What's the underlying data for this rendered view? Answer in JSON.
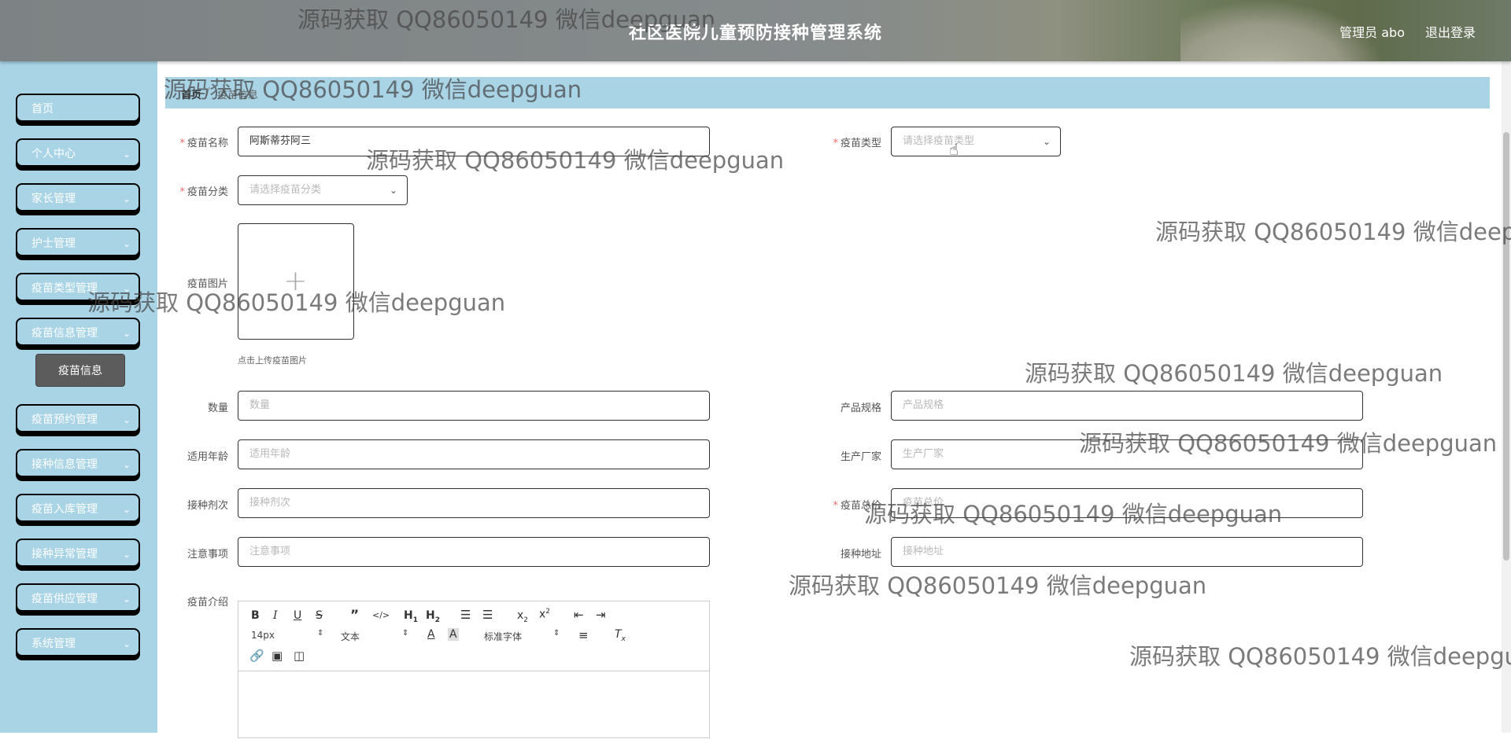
{
  "header": {
    "title": "社区医院儿童预防接种管理系统",
    "user": "管理员 abo",
    "logout": "退出登录"
  },
  "sidebar": {
    "items": [
      {
        "label": "首页",
        "has_children": false
      },
      {
        "label": "个人中心",
        "has_children": true
      },
      {
        "label": "家长管理",
        "has_children": true
      },
      {
        "label": "护士管理",
        "has_children": true
      },
      {
        "label": "疫苗类型管理",
        "has_children": true
      },
      {
        "label": "疫苗信息管理",
        "has_children": true,
        "expanded": true
      },
      {
        "label": "疫苗预约管理",
        "has_children": true
      },
      {
        "label": "接种信息管理",
        "has_children": true
      },
      {
        "label": "疫苗入库管理",
        "has_children": true
      },
      {
        "label": "接种异常管理",
        "has_children": true
      },
      {
        "label": "疫苗供应管理",
        "has_children": true
      },
      {
        "label": "系统管理",
        "has_children": true
      }
    ],
    "active_sub_item": "疫苗信息"
  },
  "breadcrumb": {
    "home": "首页",
    "current": "疫苗信息"
  },
  "form": {
    "vaccine_name": {
      "label": "疫苗名称",
      "required": true,
      "value": "阿斯蒂芬阿三"
    },
    "vaccine_type": {
      "label": "疫苗类型",
      "required": true,
      "placeholder": "请选择疫苗类型"
    },
    "vaccine_category": {
      "label": "疫苗分类",
      "required": true,
      "placeholder": "请选择疫苗分类"
    },
    "vaccine_image": {
      "label": "疫苗图片",
      "hint": "点击上传疫苗图片"
    },
    "quantity": {
      "label": "数量",
      "placeholder": "数量"
    },
    "spec": {
      "label": "产品规格",
      "placeholder": "产品规格"
    },
    "age": {
      "label": "适用年龄",
      "placeholder": "适用年龄"
    },
    "manufacturer": {
      "label": "生产厂家",
      "placeholder": "生产厂家"
    },
    "doses": {
      "label": "接种剂次",
      "placeholder": "接种剂次"
    },
    "total": {
      "label": "疫苗总价",
      "required": true,
      "placeholder": "疫苗总价"
    },
    "notes": {
      "label": "注意事项",
      "placeholder": "注意事项"
    },
    "address": {
      "label": "接种地址",
      "placeholder": "接种地址"
    },
    "intro": {
      "label": "疫苗介绍"
    }
  },
  "editor": {
    "font_size": "14px",
    "text_type": "文本",
    "font_family": "标准字体"
  },
  "watermark": "源码获取 QQ86050149 微信deepguan"
}
